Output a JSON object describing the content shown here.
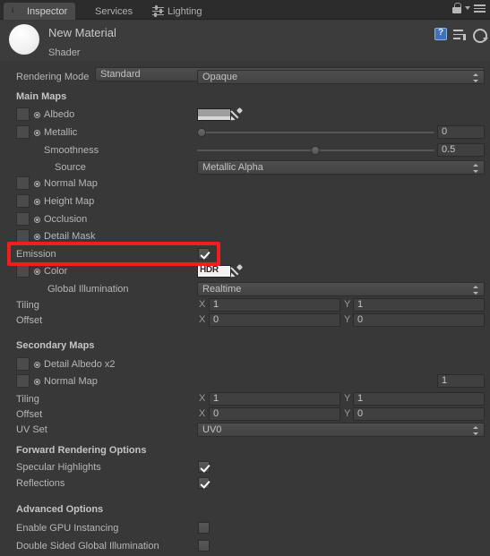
{
  "window": {
    "tabs": [
      {
        "label": "Inspector",
        "icon": "info-icon",
        "active": true
      },
      {
        "label": "Services",
        "icon": null,
        "active": false
      },
      {
        "label": "Lighting",
        "icon": "lighting-icon",
        "active": false
      }
    ],
    "right_icons": [
      "lock-icon",
      "chevron-down-icon",
      "hamburger-menu-icon"
    ]
  },
  "header": {
    "material_name": "New Material",
    "shader_label": "Shader",
    "shader_value": "Standard",
    "icons": [
      "help-book-icon",
      "preset-icon",
      "gear-icon"
    ]
  },
  "rendering_mode": {
    "label": "Rendering Mode",
    "value": "Opaque"
  },
  "sections": {
    "main_maps": "Main Maps",
    "secondary_maps": "Secondary Maps",
    "forward_rendering": "Forward Rendering Options",
    "advanced": "Advanced Options"
  },
  "main_maps": {
    "albedo": {
      "label": "Albedo",
      "swatch_color": "#9e9e9e"
    },
    "metallic": {
      "label": "Metallic",
      "value": "0",
      "slider_pct": 0
    },
    "smoothness": {
      "label": "Smoothness",
      "value": "0.5",
      "slider_pct": 50
    },
    "source": {
      "label": "Source",
      "value": "Metallic Alpha"
    },
    "normal_map": {
      "label": "Normal Map"
    },
    "height_map": {
      "label": "Height Map"
    },
    "occlusion": {
      "label": "Occlusion"
    },
    "detail_mask": {
      "label": "Detail Mask"
    },
    "emission": {
      "label": "Emission",
      "checked": true
    },
    "emission_color": {
      "label": "Color",
      "swatch_label": "HDR"
    },
    "global_illumination": {
      "label": "Global Illumination",
      "value": "Realtime"
    },
    "tiling": {
      "label": "Tiling",
      "x_label": "X",
      "x": "1",
      "y_label": "Y",
      "y": "1"
    },
    "offset": {
      "label": "Offset",
      "x_label": "X",
      "x": "0",
      "y_label": "Y",
      "y": "0"
    }
  },
  "secondary_maps": {
    "detail_albedo": {
      "label": "Detail Albedo x2"
    },
    "normal_map": {
      "label": "Normal Map",
      "value": "1"
    },
    "tiling": {
      "label": "Tiling",
      "x_label": "X",
      "x": "1",
      "y_label": "Y",
      "y": "1"
    },
    "offset": {
      "label": "Offset",
      "x_label": "X",
      "x": "0",
      "y_label": "Y",
      "y": "0"
    },
    "uv_set": {
      "label": "UV Set",
      "value": "UV0"
    }
  },
  "forward_rendering": {
    "specular_highlights": {
      "label": "Specular Highlights",
      "checked": true
    },
    "reflections": {
      "label": "Reflections",
      "checked": true
    }
  },
  "advanced": {
    "gpu_instancing": {
      "label": "Enable GPU Instancing",
      "checked": false
    },
    "double_sided_gi": {
      "label": "Double Sided Global Illumination",
      "checked": false
    }
  },
  "annotation": {
    "color": "#f01e1e",
    "target": "emission-row"
  }
}
